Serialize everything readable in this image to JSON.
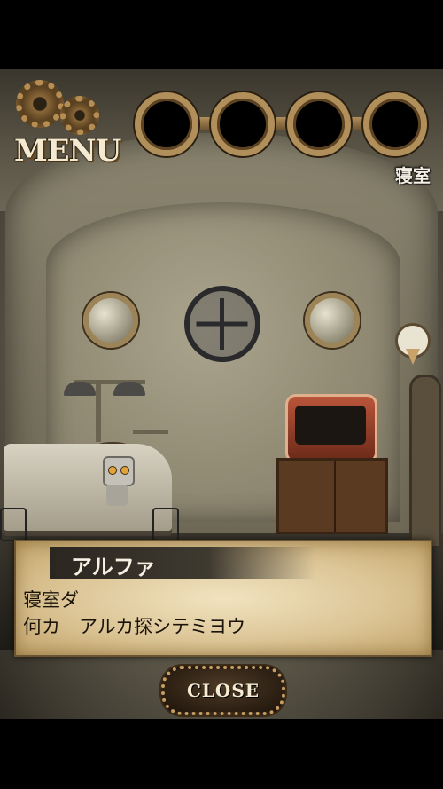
{
  "hud": {
    "menu_label": "MENU",
    "room_name": "寝室",
    "item_slots": [
      {
        "state": "empty"
      },
      {
        "state": "empty"
      },
      {
        "state": "empty"
      },
      {
        "state": "empty"
      }
    ]
  },
  "dialog": {
    "speaker": "アルファ",
    "lines": [
      "寝室ダ",
      "何カ　アルカ探シテミヨウ"
    ]
  },
  "close_label": "CLOSE",
  "colors": {
    "brass": "#b18f5b",
    "parchment": "#dcc596",
    "dialog_text": "#1b140b",
    "robot_eye": "#e2a33a"
  },
  "icons": [
    "gear-icon",
    "map-pin-icon"
  ]
}
